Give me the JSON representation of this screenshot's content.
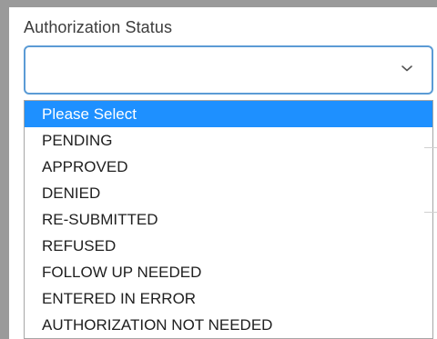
{
  "field": {
    "label": "Authorization Status",
    "selected_value": ""
  },
  "dropdown": {
    "highlighted_index": 0,
    "options": [
      "Please Select",
      "PENDING",
      "APPROVED",
      "DENIED",
      "RE-SUBMITTED",
      "REFUSED",
      "FOLLOW UP NEEDED",
      "ENTERED IN ERROR",
      "AUTHORIZATION NOT NEEDED"
    ]
  },
  "icons": {
    "chevron": "chevron-down-icon"
  },
  "colors": {
    "focus_border": "#5b9bd5",
    "highlight": "#1e90ff",
    "background": "#9a9a9a"
  }
}
